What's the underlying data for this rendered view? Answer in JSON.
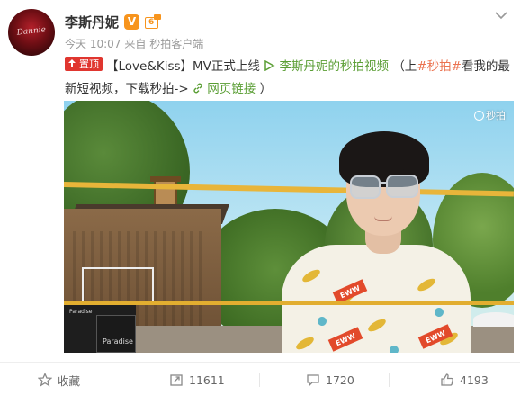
{
  "author": {
    "name": "李斯丹妮",
    "verified_badge": "V",
    "level_badge": "6"
  },
  "meta": {
    "time": "今天 10:07",
    "source": "来自 秒拍客户端"
  },
  "post": {
    "pin_label": "置顶",
    "text_part1": "【Love&Kiss】MV正式上线",
    "video_link": "李斯丹妮的秒拍视频",
    "text_part2": "（上",
    "hashtag": "#秒拍#",
    "text_part3": "看我的最新短视频，下载秒拍->",
    "web_link": "网页链接",
    "text_part4": "）"
  },
  "video": {
    "watermark": "秒拍",
    "sign_text": "Paradise"
  },
  "actions": {
    "favorite_label": "收藏",
    "repost_count": "11611",
    "comment_count": "1720",
    "like_count": "4193"
  },
  "colors": {
    "accent_orange": "#eb7350",
    "pin_red": "#e0362f",
    "link_green": "#5a9e34",
    "badge_orange": "#f7941d"
  }
}
